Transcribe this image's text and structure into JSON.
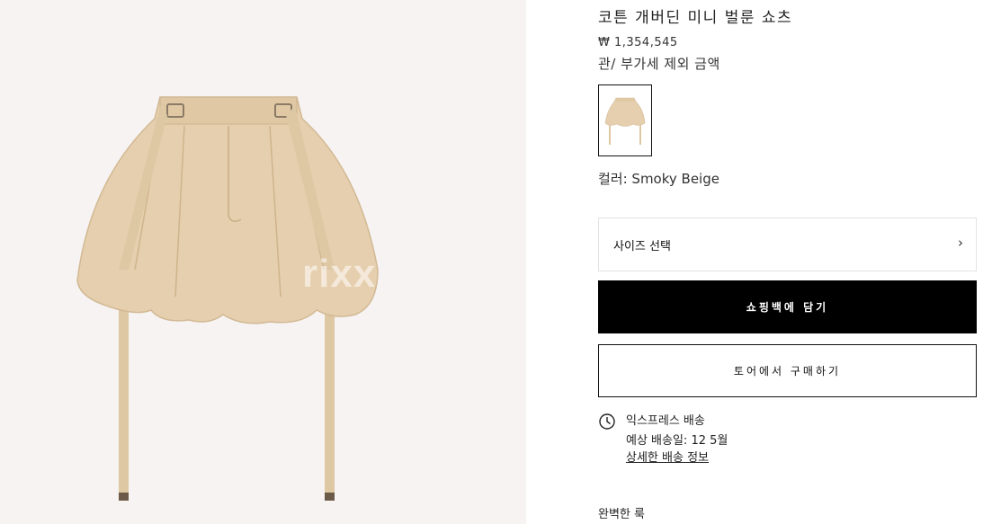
{
  "product": {
    "title": "코튼 개버딘 미니 벌룬 쇼츠",
    "price": "₩ 1,354,545",
    "tax_note": "관/ 부가세 제외 금액",
    "color_label": "컬러: Smoky Beige"
  },
  "image": {
    "watermark": "rixx",
    "product_color": "#e6cfae",
    "strap_color": "#dec7a3",
    "background_color": "#f6f3f2"
  },
  "size_select": {
    "label": "사이즈 선택",
    "chevron": "›"
  },
  "buttons": {
    "add_to_bag": "쇼핑백에 담기",
    "buy_in_store": "토어에서 구매하기"
  },
  "delivery": {
    "icon": "clock-icon",
    "title": "익스프레스 배송",
    "estimate": "예상 배송일: 12 5월",
    "details_link": "상세한 배송 정보"
  },
  "complete_look": {
    "label": "완벽한 룩"
  }
}
